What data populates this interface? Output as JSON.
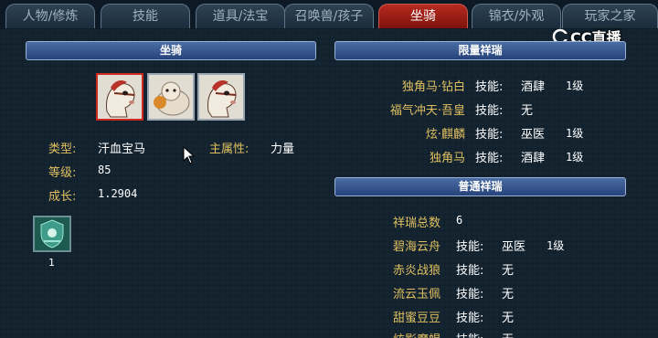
{
  "tabs": [
    {
      "label": "人物/修炼",
      "active": false
    },
    {
      "label": "技能",
      "active": false
    },
    {
      "label": "道具/法宝",
      "active": false
    },
    {
      "label": "召唤兽/孩子",
      "active": false
    },
    {
      "label": "坐骑",
      "active": true
    },
    {
      "label": "锦衣/外观",
      "active": false
    },
    {
      "label": "玩家之家",
      "active": false
    }
  ],
  "watermark": {
    "text": "CC直播"
  },
  "mount_panel": {
    "header": "坐骑",
    "type_label": "类型:",
    "type_value": "汗血宝马",
    "main_attr_label": "主属性:",
    "main_attr_value": "力量",
    "level_label": "等级:",
    "level_value": "85",
    "growth_label": "成长:",
    "growth_value": "1.2904",
    "item_count": "1"
  },
  "limited_panel": {
    "header": "限量祥瑞",
    "items": [
      {
        "name": "独角马·钻白",
        "skill_label": "技能:",
        "skill": "酒肆",
        "level": "1级"
      },
      {
        "name": "福气冲天·吾皇",
        "skill_label": "技能:",
        "skill": "无",
        "level": ""
      },
      {
        "name": "炫·麒麟",
        "skill_label": "技能:",
        "skill": "巫医",
        "level": "1级"
      },
      {
        "name": "独角马",
        "skill_label": "技能:",
        "skill": "酒肆",
        "level": "1级"
      }
    ]
  },
  "normal_panel": {
    "header": "普通祥瑞",
    "total_label": "祥瑞总数",
    "total_value": "6",
    "items": [
      {
        "name": "碧海云舟",
        "skill_label": "技能:",
        "skill": "巫医",
        "level": "1级"
      },
      {
        "name": "赤炎战狼",
        "skill_label": "技能:",
        "skill": "无",
        "level": ""
      },
      {
        "name": "流云玉佩",
        "skill_label": "技能:",
        "skill": "无",
        "level": ""
      },
      {
        "name": "甜蜜豆豆",
        "skill_label": "技能:",
        "skill": "无",
        "level": ""
      },
      {
        "name": "炫影魔蝎",
        "skill_label": "技能:",
        "skill": "无",
        "level": ""
      }
    ]
  },
  "colors": {
    "accent_red": "#b62a20",
    "label_gold": "#e0c060",
    "header_blue": "#3a5a94"
  }
}
